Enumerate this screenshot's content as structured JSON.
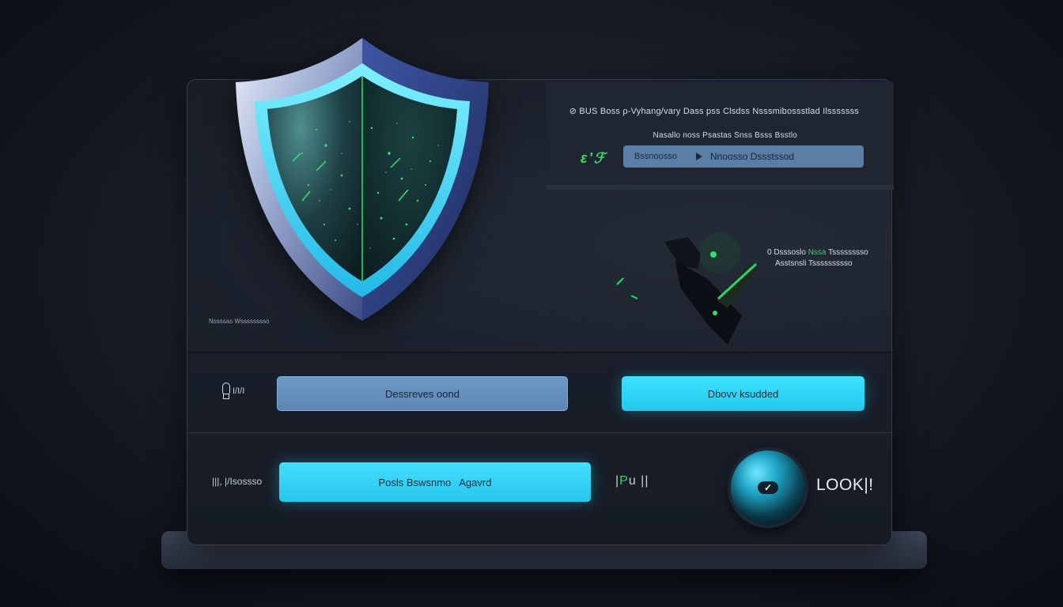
{
  "info": {
    "line1": "⊘ BUS Boss ρ-Vyhang/vary Dass pss Clsdss Nsssmibossstlad Ilsssssss",
    "line2": "Nasallo noss Psastas Snss Bsss Bsstlo",
    "status_glyph": "ɛ'ℱ",
    "bar_left": "Bssnoosso",
    "bar_right": "Nnoosso Dssstssod",
    "play_icon": "play-icon"
  },
  "arm": {
    "label1_prefix": "0 Dsssoslo",
    "label1_green": "Nssa",
    "label1_suffix": "Tsssssssso",
    "label2": "Asstsnsli Tssssssssso"
  },
  "hero_caption": "Nssssas Wsssssssso",
  "row1": {
    "icon_label": "I/I/I",
    "left_button": "Dessreves oond",
    "right_button": "Dbovv ksudded"
  },
  "row2": {
    "icon_label": "|||, |/Isossso",
    "button_left": "Posls Bswsnmo",
    "button_right": "Agavrd",
    "mid_glyph_left": "|",
    "mid_glyph_green": "P",
    "mid_glyph_right": "u ||",
    "lock_label": "LOOK|!",
    "orb_icon": "check-icon"
  },
  "colors": {
    "accent_cyan": "#2ccdf2",
    "accent_green": "#30d46b",
    "accent_blue": "#6e99c6",
    "panel_bg": "#1b212c"
  }
}
